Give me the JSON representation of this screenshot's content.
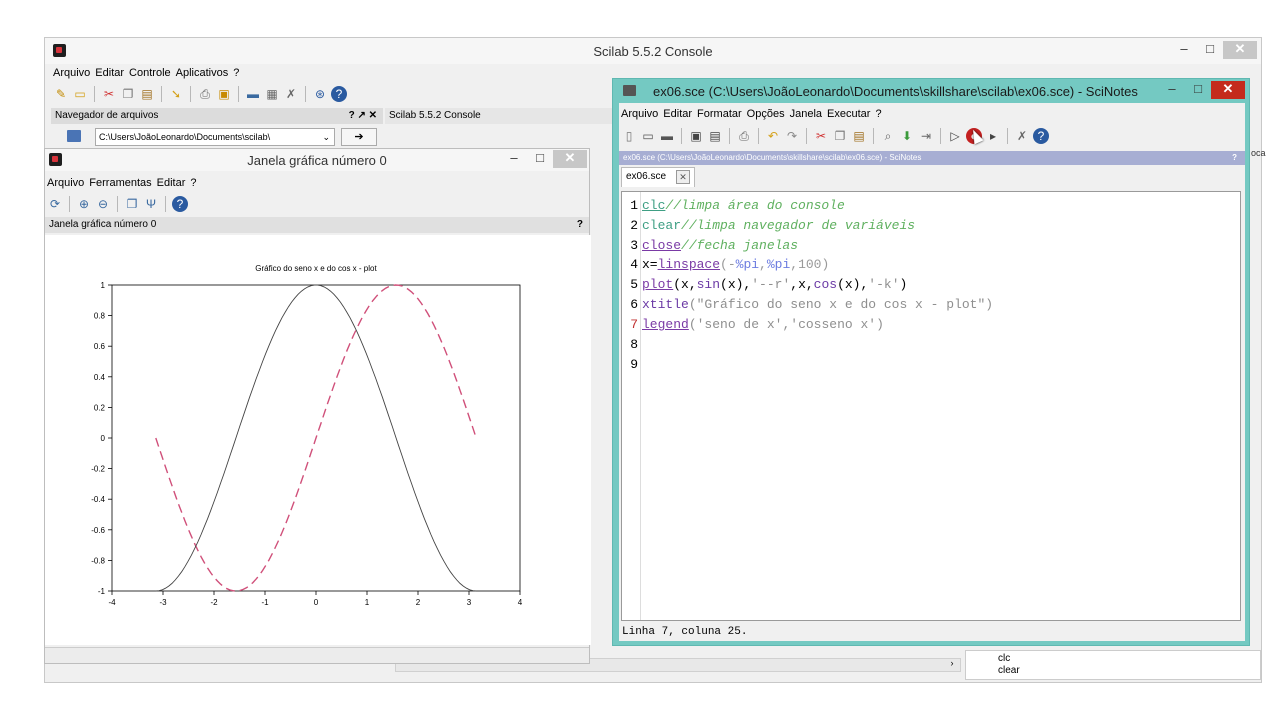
{
  "console": {
    "title": "Scilab 5.5.2 Console",
    "menu": [
      "Arquivo",
      "Editar",
      "Controle",
      "Aplicativos",
      "?"
    ],
    "file_browser_title": "Navegador de arquivos",
    "file_browser_buttons": "? ↗ ✕",
    "path": "C:\\Users\\JoãoLeonardo\\Documents\\scilab\\",
    "console_tab": "Scilab 5.5.2 Console",
    "right_edge_text": "oca",
    "variable_items": [
      "clc",
      "clear"
    ]
  },
  "graphic": {
    "title": "Janela gráfica número 0",
    "menu": [
      "Arquivo",
      "Ferramentas",
      "Editar",
      "?"
    ],
    "panel_title": "Janela gráfica número 0",
    "panel_help": "?"
  },
  "chart_data": {
    "type": "line",
    "title": "Gráfico do seno x e do cos x - plot",
    "xlim": [
      -4,
      4
    ],
    "ylim": [
      -1,
      1
    ],
    "x_ticks": [
      "-4",
      "-3",
      "-2",
      "-1",
      "0",
      "1",
      "2",
      "3",
      "4"
    ],
    "y_ticks": [
      "-1",
      "-0.8",
      "-0.6",
      "-0.4",
      "-0.2",
      "0",
      "0.2",
      "0.4",
      "0.6",
      "0.8",
      "1"
    ],
    "grid": false,
    "series": [
      {
        "style": "dashed",
        "color": "#d0507a",
        "func": "sin",
        "x_range": [
          -3.14159,
          3.14159
        ],
        "points": 100
      },
      {
        "style": "solid",
        "color": "#444444",
        "func": "cos",
        "x_range": [
          -3.14159,
          3.14159
        ],
        "points": 100
      }
    ]
  },
  "scinotes": {
    "title": "ex06.sce (C:\\Users\\JoãoLeonardo\\Documents\\skillshare\\scilab\\ex06.sce) - SciNotes",
    "menu": [
      "Arquivo",
      "Editar",
      "Formatar",
      "Opções",
      "Janela",
      "Executar",
      "?"
    ],
    "header": "ex06.sce (C:\\Users\\JoãoLeonardo\\Documents\\skillshare\\scilab\\ex06.sce) - SciNotes",
    "header_help": "?",
    "tab": "ex06.sce",
    "line_numbers": [
      "1",
      "2",
      "3",
      "4",
      "5",
      "6",
      "7",
      "8",
      "9"
    ],
    "code": {
      "l1_cmd": "clc",
      "l1_comment": "//limpa área do console",
      "l2_cmd": "clear",
      "l2_comment": "//limpa navegador de variáveis",
      "l3_cmd": "close",
      "l3_comment": "//fecha janelas",
      "l4_a": "x=",
      "l4_fn": "linspace",
      "l4_b": "(-",
      "l4_c1": "%pi",
      "l4_d": ",",
      "l4_c2": "%pi",
      "l4_e": ",",
      "l4_n": "100",
      "l4_f": ")",
      "l5_fn": "plot",
      "l5_a": "(x,",
      "l5_sin": "sin",
      "l5_b": "(x),",
      "l5_s1": "'--r'",
      "l5_c": ",x,",
      "l5_cos": "cos",
      "l5_d": "(x),",
      "l5_s2": "'-k'",
      "l5_e": ")",
      "l6_fn": "xtitle",
      "l6_a": "(",
      "l6_s": "\"Gráfico do seno x e do cos x - plot\"",
      "l6_b": ")",
      "l7_fn": "legend",
      "l7_a": "(",
      "l7_s1": "'seno de x'",
      "l7_b": ",",
      "l7_s2": "'cosseno x'",
      "l7_c": ")"
    },
    "status": "Linha 7, coluna 25."
  }
}
